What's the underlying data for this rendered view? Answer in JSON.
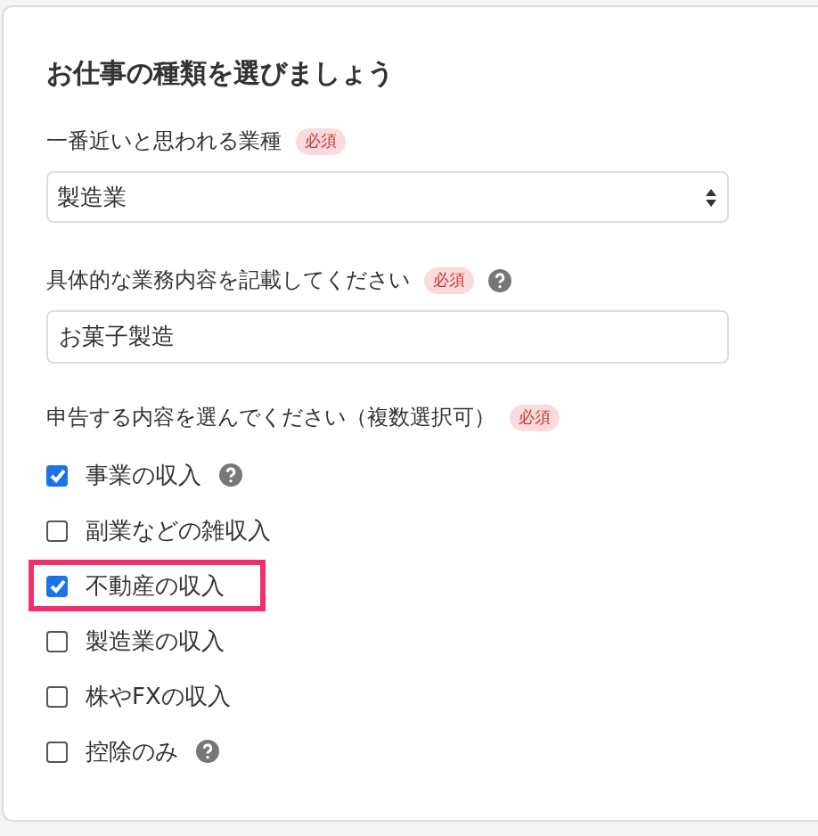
{
  "title": "お仕事の種類を選びましょう",
  "industry": {
    "label": "一番近いと思われる業種",
    "badge": "必須",
    "value": "製造業"
  },
  "details": {
    "label": "具体的な業務内容を記載してください",
    "badge": "必須",
    "help": true,
    "value": "お菓子製造"
  },
  "income": {
    "label": "申告する内容を選んでください（複数選択可）",
    "badge": "必須",
    "options": [
      {
        "label": "事業の収入",
        "checked": true,
        "help": true,
        "highlighted": false
      },
      {
        "label": "副業などの雑収入",
        "checked": false,
        "help": false,
        "highlighted": false
      },
      {
        "label": "不動産の収入",
        "checked": true,
        "help": false,
        "highlighted": true
      },
      {
        "label": "製造業の収入",
        "checked": false,
        "help": false,
        "highlighted": false
      },
      {
        "label": "株やFXの収入",
        "checked": false,
        "help": false,
        "highlighted": false
      },
      {
        "label": "控除のみ",
        "checked": false,
        "help": true,
        "highlighted": false
      }
    ]
  }
}
